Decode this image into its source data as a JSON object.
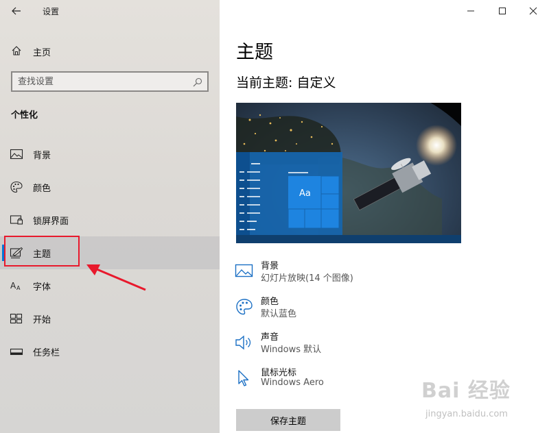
{
  "window": {
    "title": "设置",
    "minimize_icon": "minimize-icon",
    "maximize_icon": "maximize-icon",
    "close_icon": "close-icon"
  },
  "sidebar": {
    "home_label": "主页",
    "search_placeholder": "查找设置",
    "section_title": "个性化",
    "items": [
      {
        "label": "背景",
        "icon": "picture-icon"
      },
      {
        "label": "颜色",
        "icon": "palette-icon"
      },
      {
        "label": "锁屏界面",
        "icon": "lock-screen-icon"
      },
      {
        "label": "主题",
        "icon": "theme-brush-icon",
        "selected": true
      },
      {
        "label": "字体",
        "icon": "font-icon"
      },
      {
        "label": "开始",
        "icon": "start-grid-icon"
      },
      {
        "label": "任务栏",
        "icon": "taskbar-icon"
      }
    ]
  },
  "main": {
    "title": "主题",
    "current_theme": "当前主题: 自定义",
    "preview_tile_text": "Aa",
    "options": [
      {
        "title": "背景",
        "value": "幻灯片放映(14 个图像)",
        "icon": "picture-icon"
      },
      {
        "title": "颜色",
        "value": "默认蓝色",
        "icon": "palette-icon"
      },
      {
        "title": "声音",
        "value": "Windows 默认",
        "icon": "speaker-icon"
      },
      {
        "title": "鼠标光标",
        "value": "Windows Aero",
        "icon": "cursor-icon"
      }
    ],
    "save_button": "保存主题"
  },
  "watermark": {
    "brand": "Bai 经验",
    "url": "jingyan.baidu.com"
  },
  "colors": {
    "accent": "#0078d7",
    "annotation": "#e8192c",
    "sidebar_bg": "#dcd9d5",
    "selected_bg": "#c6c5c4"
  }
}
